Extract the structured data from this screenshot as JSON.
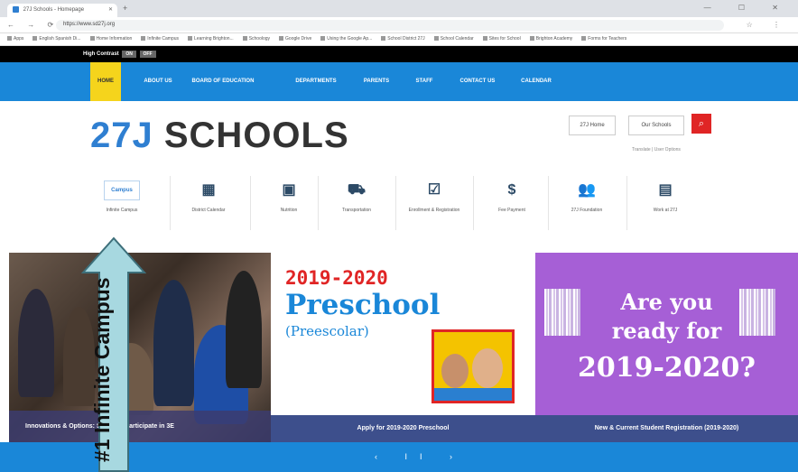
{
  "browser": {
    "tab_title": "27J Schools - Homepage",
    "tab_close": "✕",
    "new_tab": "+",
    "window_controls": "— ☐ ✕",
    "nav_buttons": "← → ⟳",
    "url": "https://www.sd27j.org",
    "addr_icons": "☆ ⋮",
    "bookmarks": [
      "Apps",
      "English Spanish Di...",
      "Home Information",
      "Infinite Campus",
      "Learning Brighton...",
      "Schoology",
      "Google Drive",
      "Using the Google Ap...",
      "School District 27J",
      "School Calendar",
      "Sites for School",
      "Brighton Academy",
      "Forms for Teachers"
    ]
  },
  "topbar": {
    "high_contrast": "High Contrast",
    "on": "ON",
    "off": "OFF"
  },
  "nav": {
    "items": [
      "HOME",
      "ABOUT US",
      "BOARD OF EDUCATION",
      "DEPARTMENTS",
      "PARENTS",
      "STAFF",
      "CONTACT US",
      "CALENDAR"
    ]
  },
  "header": {
    "logo_num": "27J",
    "logo_text": " SCHOOLS",
    "home_btn": "27J Home",
    "schools_btn": "Our Schools",
    "translate": "Translate | User Options"
  },
  "quicklinks": [
    {
      "label": "Infinite Campus",
      "icon": "infinite-campus-logo",
      "glyph": "Campus"
    },
    {
      "label": "District Calendar",
      "icon": "calendar-icon",
      "glyph": "▦"
    },
    {
      "label": "Nutrition",
      "icon": "nutrition-calendar-icon",
      "glyph": "▣"
    },
    {
      "label": "Transportation",
      "icon": "bus-icon",
      "glyph": "⛟"
    },
    {
      "label": "Enrollment & Registration",
      "icon": "checklist-icon",
      "glyph": "☑"
    },
    {
      "label": "Fee Payment",
      "icon": "dollar-icon",
      "glyph": "$"
    },
    {
      "label": "27J Foundation",
      "icon": "people-icon",
      "glyph": "👥"
    },
    {
      "label": "Work at 27J",
      "icon": "briefcase-icon",
      "glyph": "▤"
    }
  ],
  "hero": {
    "left_caption": "Innovations & Options: Students participate in 3E",
    "mid_year": "2019-2020",
    "mid_title": "Preschool",
    "mid_sub": "(Preescolar)",
    "mid_caption": "Apply for 2019-2020 Preschool",
    "right_line1": "Are you",
    "right_line2": "ready for",
    "right_line3": "2019-2020?",
    "right_caption": "New & Current Student Registration (2019-2020)"
  },
  "slider": {
    "controls": "‹ II ›"
  },
  "callout": {
    "number": "#1",
    "text": "Infinite Campus"
  },
  "colors": {
    "nav_blue": "#1a87d8",
    "active_yellow": "#f5d41c",
    "search_red": "#e02525",
    "purple": "#a65fd6",
    "callout_teal": "#a7d8e0"
  }
}
